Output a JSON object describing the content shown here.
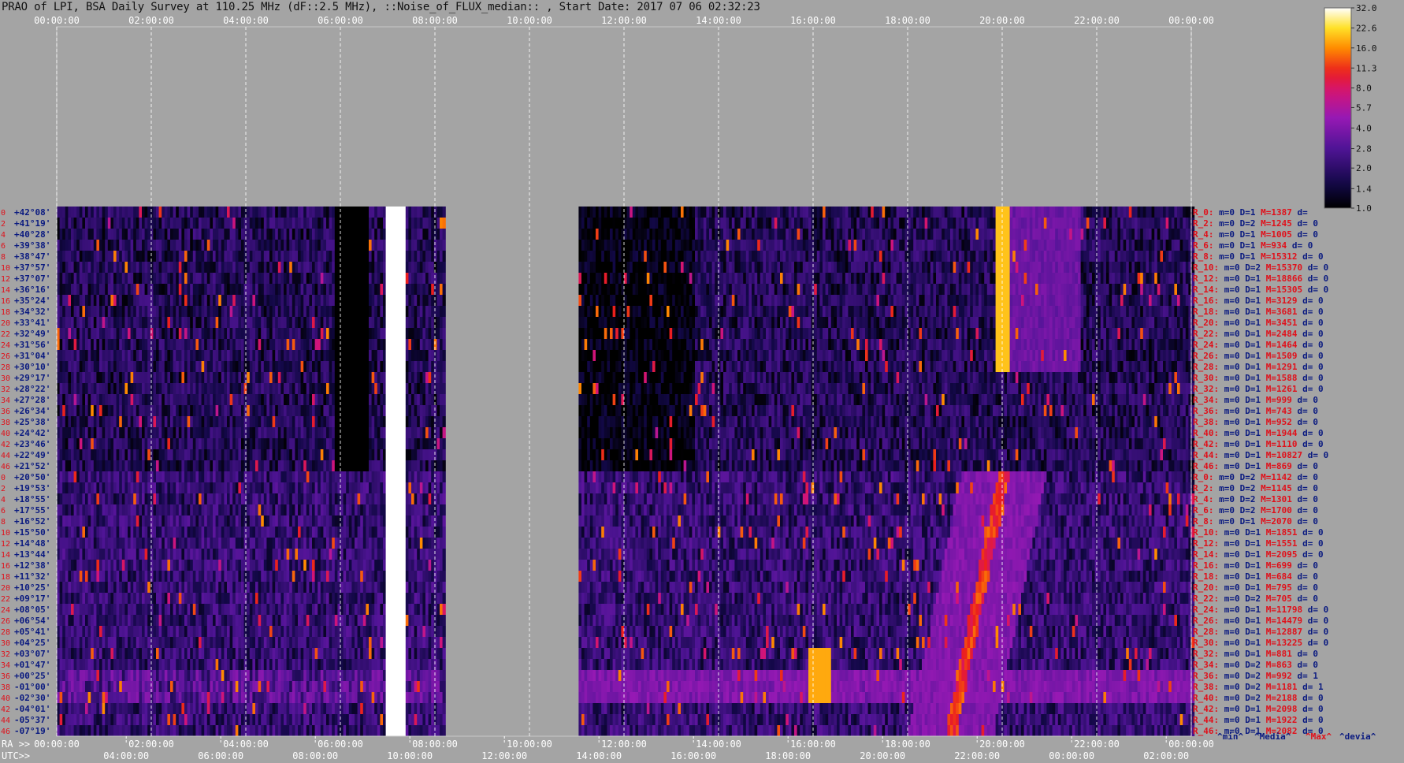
{
  "chart_data": {
    "type": "heatmap",
    "title": "PRAO of LPI, BSA Daily Survey at 110.25 MHz (dF::2.5 MHz), ::Noise_of_FLUX_median:: , Start Date: 2017 07 06 02:32:23",
    "x_top_ticks": [
      "00:00:00",
      "02:00:00",
      "04:00:00",
      "06:00:00",
      "08:00:00",
      "10:00:00",
      "12:00:00",
      "14:00:00",
      "16:00:00",
      "18:00:00",
      "20:00:00",
      "22:00:00",
      "00:00:00"
    ],
    "ra_label": "RA >>",
    "ra_ticks": [
      "00:00:00",
      "02:00:00",
      "04:00:00",
      "06:00:00",
      "08:00:00",
      "10:00:00",
      "12:00:00",
      "14:00:00",
      "16:00:00",
      "18:00:00",
      "20:00:00",
      "22:00:00",
      "00:00:00"
    ],
    "utc_label": "UTC>>",
    "utc_ticks": [
      "04:00:00",
      "06:00:00",
      "08:00:00",
      "10:00:00",
      "12:00:00",
      "14:00:00",
      "16:00:00",
      "18:00:00",
      "20:00:00",
      "22:00:00",
      "00:00:00",
      "02:00:00"
    ],
    "dec_labels": [
      "+42°08'",
      "+41°19'",
      "+40°28'",
      "+39°38'",
      "+38°47'",
      "+37°57'",
      "+37°07'",
      "+36°16'",
      "+35°24'",
      "+34°32'",
      "+33°41'",
      "+32°49'",
      "+31°56'",
      "+31°04'",
      "+30°10'",
      "+29°17'",
      "+28°22'",
      "+27°28'",
      "+26°34'",
      "+25°38'",
      "+24°42'",
      "+23°46'",
      "+22°49'",
      "+21°52'",
      "+20°50'",
      "+19°53'",
      "+18°55'",
      "+17°55'",
      "+16°52'",
      "+15°50'",
      "+14°48'",
      "+13°44'",
      "+12°38'",
      "+11°32'",
      "+10°25'",
      "+09°17'",
      "+08°05'",
      "+06°54'",
      "+05°41'",
      "+04°25'",
      "+03°07'",
      "+01°47'",
      "+00°25'",
      "-01°00'",
      "-02°30'",
      "-04°01'",
      "-05°37'",
      "-07°19'"
    ],
    "row_indices": [
      "0",
      "2",
      "4",
      "6",
      "8",
      "10",
      "12",
      "14",
      "16",
      "18",
      "20",
      "22",
      "24",
      "26",
      "28",
      "30",
      "32",
      "34",
      "36",
      "38",
      "40",
      "42",
      "44",
      "46",
      "0",
      "2",
      "4",
      "6",
      "8",
      "10",
      "12",
      "14",
      "16",
      "18",
      "20",
      "22",
      "24",
      "26",
      "28",
      "30",
      "32",
      "34",
      "36",
      "38",
      "40",
      "42",
      "44",
      "46"
    ],
    "row_stats": [
      {
        "r": "R_0:",
        "m": "m=0",
        "d": "D=1",
        "M": "M=1387",
        "dv": "d="
      },
      {
        "r": "R_2:",
        "m": "m=0",
        "d": "D=2",
        "M": "M=1245",
        "dv": "d= 0"
      },
      {
        "r": "R_4:",
        "m": "m=0",
        "d": "D=1",
        "M": "M=1005",
        "dv": "d= 0"
      },
      {
        "r": "R_6:",
        "m": "m=0",
        "d": "D=1",
        "M": "M=934",
        "dv": "d= 0"
      },
      {
        "r": "R_8:",
        "m": "m=0",
        "d": "D=1",
        "M": "M=15312",
        "dv": "d= 0"
      },
      {
        "r": "R_10:",
        "m": "m=0",
        "d": "D=2",
        "M": "M=15370",
        "dv": "d= 0"
      },
      {
        "r": "R_12:",
        "m": "m=0",
        "d": "D=1",
        "M": "M=18866",
        "dv": "d= 0"
      },
      {
        "r": "R_14:",
        "m": "m=0",
        "d": "D=1",
        "M": "M=15305",
        "dv": "d= 0"
      },
      {
        "r": "R_16:",
        "m": "m=0",
        "d": "D=1",
        "M": "M=3129",
        "dv": "d= 0"
      },
      {
        "r": "R_18:",
        "m": "m=0",
        "d": "D=1",
        "M": "M=3681",
        "dv": "d= 0"
      },
      {
        "r": "R_20:",
        "m": "m=0",
        "d": "D=1",
        "M": "M=3451",
        "dv": "d= 0"
      },
      {
        "r": "R_22:",
        "m": "m=0",
        "d": "D=1",
        "M": "M=2484",
        "dv": "d= 0"
      },
      {
        "r": "R_24:",
        "m": "m=0",
        "d": "D=1",
        "M": "M=1464",
        "dv": "d= 0"
      },
      {
        "r": "R_26:",
        "m": "m=0",
        "d": "D=1",
        "M": "M=1509",
        "dv": "d= 0"
      },
      {
        "r": "R_28:",
        "m": "m=0",
        "d": "D=1",
        "M": "M=1291",
        "dv": "d= 0"
      },
      {
        "r": "R_30:",
        "m": "m=0",
        "d": "D=1",
        "M": "M=1588",
        "dv": "d= 0"
      },
      {
        "r": "R_32:",
        "m": "m=0",
        "d": "D=1",
        "M": "M=1261",
        "dv": "d= 0"
      },
      {
        "r": "R_34:",
        "m": "m=0",
        "d": "D=1",
        "M": "M=999",
        "dv": "d= 0"
      },
      {
        "r": "R_36:",
        "m": "m=0",
        "d": "D=1",
        "M": "M=743",
        "dv": "d= 0"
      },
      {
        "r": "R_38:",
        "m": "m=0",
        "d": "D=1",
        "M": "M=952",
        "dv": "d= 0"
      },
      {
        "r": "R_40:",
        "m": "m=0",
        "d": "D=1",
        "M": "M=1944",
        "dv": "d= 0"
      },
      {
        "r": "R_42:",
        "m": "m=0",
        "d": "D=1",
        "M": "M=1110",
        "dv": "d= 0"
      },
      {
        "r": "R_44:",
        "m": "m=0",
        "d": "D=1",
        "M": "M=10827",
        "dv": "d= 0"
      },
      {
        "r": "R_46:",
        "m": "m=0",
        "d": "D=1",
        "M": "M=869",
        "dv": "d= 0"
      },
      {
        "r": "R_0:",
        "m": "m=0",
        "d": "D=2",
        "M": "M=1142",
        "dv": "d= 0"
      },
      {
        "r": "R_2:",
        "m": "m=0",
        "d": "D=2",
        "M": "M=1145",
        "dv": "d= 0"
      },
      {
        "r": "R_4:",
        "m": "m=0",
        "d": "D=2",
        "M": "M=1301",
        "dv": "d= 0"
      },
      {
        "r": "R_6:",
        "m": "m=0",
        "d": "D=2",
        "M": "M=1700",
        "dv": "d= 0"
      },
      {
        "r": "R_8:",
        "m": "m=0",
        "d": "D=1",
        "M": "M=2070",
        "dv": "d= 0"
      },
      {
        "r": "R_10:",
        "m": "m=0",
        "d": "D=1",
        "M": "M=1851",
        "dv": "d= 0"
      },
      {
        "r": "R_12:",
        "m": "m=0",
        "d": "D=1",
        "M": "M=1551",
        "dv": "d= 0"
      },
      {
        "r": "R_14:",
        "m": "m=0",
        "d": "D=1",
        "M": "M=2095",
        "dv": "d= 0"
      },
      {
        "r": "R_16:",
        "m": "m=0",
        "d": "D=1",
        "M": "M=699",
        "dv": "d= 0"
      },
      {
        "r": "R_18:",
        "m": "m=0",
        "d": "D=1",
        "M": "M=684",
        "dv": "d= 0"
      },
      {
        "r": "R_20:",
        "m": "m=0",
        "d": "D=1",
        "M": "M=795",
        "dv": "d= 0"
      },
      {
        "r": "R_22:",
        "m": "m=0",
        "d": "D=2",
        "M": "M=705",
        "dv": "d= 0"
      },
      {
        "r": "R_24:",
        "m": "m=0",
        "d": "D=1",
        "M": "M=11798",
        "dv": "d= 0"
      },
      {
        "r": "R_26:",
        "m": "m=0",
        "d": "D=1",
        "M": "M=14479",
        "dv": "d= 0"
      },
      {
        "r": "R_28:",
        "m": "m=0",
        "d": "D=1",
        "M": "M=12887",
        "dv": "d= 0"
      },
      {
        "r": "R_30:",
        "m": "m=0",
        "d": "D=1",
        "M": "M=13225",
        "dv": "d= 0"
      },
      {
        "r": "R_32:",
        "m": "m=0",
        "d": "D=1",
        "M": "M=881",
        "dv": "d= 0"
      },
      {
        "r": "R_34:",
        "m": "m=0",
        "d": "D=2",
        "M": "M=863",
        "dv": "d= 0"
      },
      {
        "r": "R_36:",
        "m": "m=0",
        "d": "D=2",
        "M": "M=992",
        "dv": "d= 1"
      },
      {
        "r": "R_38:",
        "m": "m=0",
        "d": "D=2",
        "M": "M=1181",
        "dv": "d= 1"
      },
      {
        "r": "R_40:",
        "m": "m=0",
        "d": "D=2",
        "M": "M=2188",
        "dv": "d= 0"
      },
      {
        "r": "R_42:",
        "m": "m=0",
        "d": "D=1",
        "M": "M=2098",
        "dv": "d= 0"
      },
      {
        "r": "R_44:",
        "m": "m=0",
        "d": "D=1",
        "M": "M=1922",
        "dv": "d= 0"
      },
      {
        "r": "R_46:",
        "m": "m=0",
        "d": "D=1",
        "M": "M=2082",
        "dv": "d= 0"
      }
    ],
    "stats_legend": [
      {
        "text": "^min^",
        "color": "#0a1a80"
      },
      {
        "text": "^Media^",
        "color": "#0a1a80"
      },
      {
        "text": "^Max^",
        "color": "#e0101a"
      },
      {
        "text": "^devia^",
        "color": "#0a1a80"
      }
    ],
    "colorbar_ticks": [
      "32.0",
      "22.6",
      "16.0",
      "11.3",
      "8.0",
      "5.7",
      "4.0",
      "2.8",
      "2.0",
      "1.4",
      "1.0"
    ],
    "colorbar_scale": "log",
    "colorbar_range": [
      1.0,
      32.0
    ],
    "ra_range_hours": [
      0,
      24
    ],
    "data_gap_hours": [
      8.25,
      11.0
    ],
    "features": [
      {
        "name": "bright transit source",
        "ra_hours": [
          6.95,
          7.35
        ],
        "rows": "all",
        "level": 32
      },
      {
        "name": "blank segment",
        "ra_hours": [
          5.85,
          6.55
        ],
        "rows": [
          0,
          23
        ],
        "level": 1.0
      },
      {
        "name": "diagonal drift track",
        "ra_hours": [
          18.9,
          20.0
        ],
        "rows": [
          24,
          47
        ],
        "level": 12
      },
      {
        "name": "vertical bright track",
        "ra_hours": [
          19.85,
          20.1
        ],
        "rows": [
          0,
          14
        ],
        "level": 20
      },
      {
        "name": "horizontal band",
        "ra_hours": [
          11.0,
          24.0
        ],
        "rows": [
          42,
          44
        ],
        "level": 4
      },
      {
        "name": "bright clump",
        "ra_hours": [
          15.9,
          16.35
        ],
        "rows": [
          40,
          44
        ],
        "level": 18
      }
    ],
    "colors": {
      "background": "#a4a4a4",
      "index_red": "#e0101a",
      "stats_blue": "#0a1a80",
      "grid": "#ffffff"
    }
  }
}
